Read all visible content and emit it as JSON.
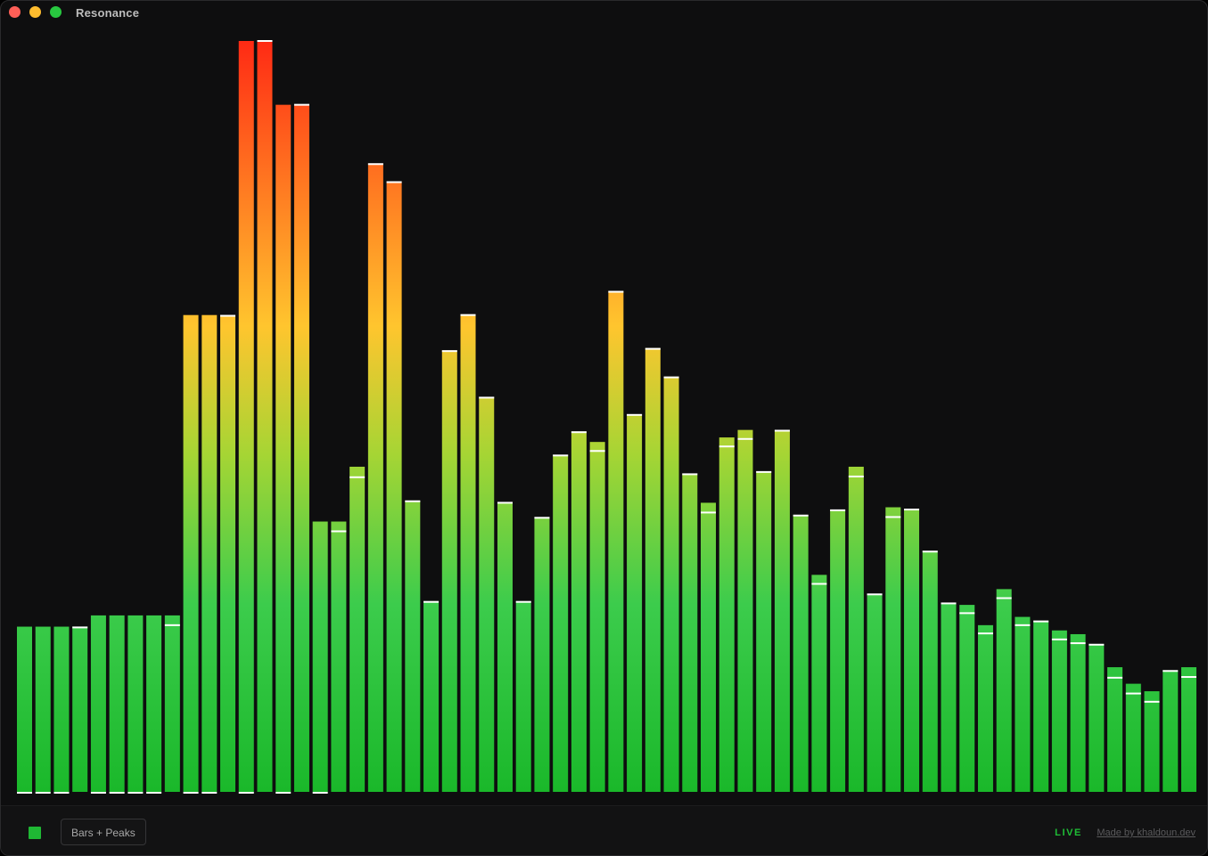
{
  "app": {
    "title": "Resonance"
  },
  "footer": {
    "mode_label": "Bars + Peaks",
    "status": "LIVE",
    "credit": "Made by khaldoun.dev",
    "swatch_color": "#1fb834"
  },
  "colors": {
    "low": "#1ab82a",
    "mid": "#ffc52e",
    "high": "#ff2a14",
    "peak": "#ffffff",
    "background": "#0e0e0f"
  },
  "chart_data": {
    "type": "bar",
    "ylim": [
      0,
      1
    ],
    "values": [
      0.22,
      0.22,
      0.22,
      0.22,
      0.235,
      0.235,
      0.235,
      0.235,
      0.235,
      0.635,
      0.635,
      0.635,
      1.0,
      1.0,
      0.915,
      0.915,
      0.36,
      0.36,
      0.433,
      0.837,
      0.813,
      0.388,
      0.254,
      0.588,
      0.636,
      0.526,
      0.386,
      0.254,
      0.366,
      0.449,
      0.48,
      0.466,
      0.667,
      0.503,
      0.591,
      0.553,
      0.424,
      0.385,
      0.472,
      0.482,
      0.427,
      0.482,
      0.369,
      0.289,
      0.376,
      0.433,
      0.264,
      0.379,
      0.377,
      0.321,
      0.252,
      0.249,
      0.222,
      0.27,
      0.233,
      0.228,
      0.215,
      0.21,
      0.197,
      0.166,
      0.144,
      0.134,
      0.162,
      0.166
    ],
    "peaks": [
      0.0,
      0.0,
      0.0,
      0.219,
      0.0,
      0.0,
      0.0,
      0.0,
      0.222,
      0.0,
      0.0,
      0.634,
      0.0,
      1.0,
      0.0,
      0.915,
      0.0,
      0.347,
      0.419,
      0.836,
      0.812,
      0.387,
      0.253,
      0.587,
      0.635,
      0.525,
      0.385,
      0.253,
      0.365,
      0.448,
      0.479,
      0.454,
      0.666,
      0.502,
      0.59,
      0.552,
      0.423,
      0.372,
      0.46,
      0.47,
      0.426,
      0.481,
      0.368,
      0.277,
      0.375,
      0.42,
      0.263,
      0.366,
      0.376,
      0.32,
      0.251,
      0.238,
      0.211,
      0.258,
      0.222,
      0.227,
      0.203,
      0.198,
      0.196,
      0.152,
      0.131,
      0.12,
      0.161,
      0.153
    ]
  }
}
